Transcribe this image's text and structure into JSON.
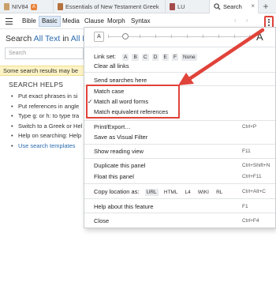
{
  "tabs": [
    {
      "label": "NIV84",
      "badge": "A",
      "book_color": "#c9a06a"
    },
    {
      "label": "Essentials of New Testament Greek",
      "book_color": "#b5723f"
    },
    {
      "label": "LU",
      "book_color": "#a44b4b"
    },
    {
      "label": "Search",
      "close": "×",
      "active": true
    }
  ],
  "new_tab": "+",
  "toolbar": {
    "items": [
      "Bible",
      "Basic",
      "Media",
      "Clause",
      "Morph",
      "Syntax"
    ],
    "selected": "Basic",
    "nav": "‹ ›"
  },
  "search": {
    "title_prefix": "Search",
    "title_scope": "All Text",
    "title_in": "in",
    "title_target": "All Re",
    "placeholder": "Search",
    "warning": "Some search results may be"
  },
  "helps": {
    "heading": "SEARCH HELPS",
    "items": [
      "Put exact phrases in si",
      "Put references in angle",
      "Type g: or h: to type tra",
      "Switch to a Greek or Hel",
      "Help on searching: Help",
      "Use search templates"
    ]
  },
  "menu": {
    "font_small": "A",
    "font_large": "A",
    "link_set_label": "Link set:",
    "link_sets": [
      "A",
      "B",
      "C",
      "D",
      "E",
      "F",
      "None"
    ],
    "clear_links": "Clear all links",
    "send_searches": "Send searches here",
    "match_case": "Match case",
    "match_word_forms": "Match all word forms",
    "match_word_forms_check": "✓",
    "match_equivalent": "Match equivalent references",
    "print_export": "Print/Export…",
    "print_shortcut": "Ctrl+P",
    "save_visual": "Save as Visual Filter",
    "reading_view": "Show reading view",
    "reading_shortcut": "F11",
    "duplicate": "Duplicate this panel",
    "duplicate_shortcut": "Ctrl+Shift+N",
    "float_panel": "Float this panel",
    "float_shortcut": "Ctrl+F11",
    "copy_location": "Copy location as:",
    "copy_formats": [
      "URL",
      "HTML",
      "L4",
      "WIKI",
      "RL"
    ],
    "copy_shortcut": "Ctrl+Alt+C",
    "help_feature": "Help about this feature",
    "help_shortcut": "F1",
    "close": "Close",
    "close_shortcut": "Ctrl+F4"
  },
  "colors": {
    "annotation": "#e0433a",
    "link": "#2b6cb0",
    "warning_bg": "#fdf3c4"
  }
}
